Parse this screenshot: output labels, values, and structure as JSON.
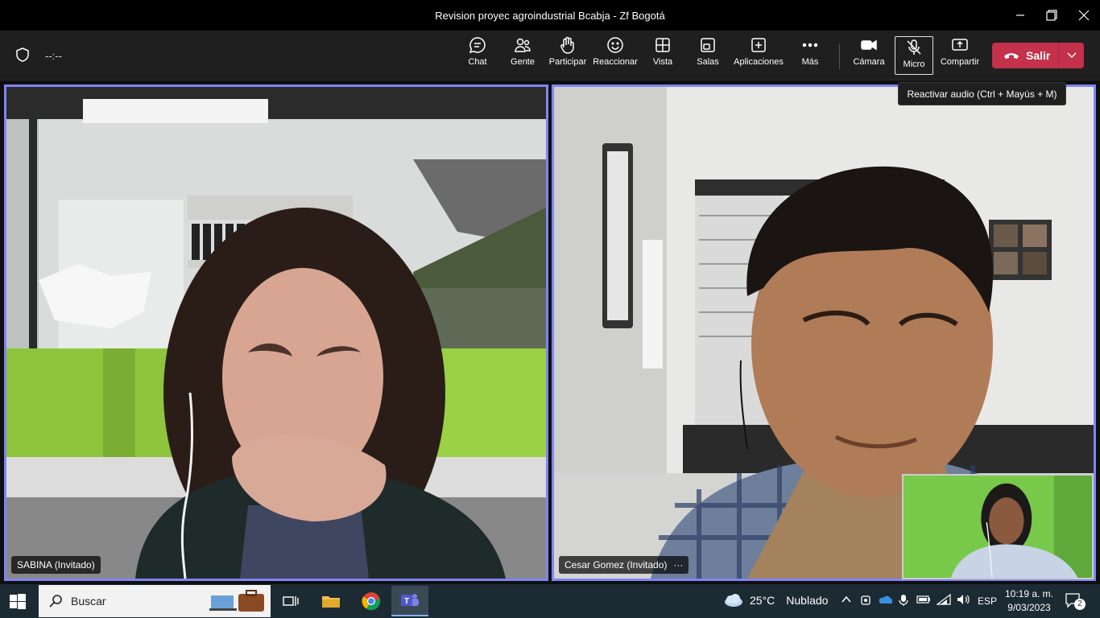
{
  "window": {
    "title": "Revision proyec agroindustrial Bcabja - Zf Bogotá"
  },
  "toolbar": {
    "timer": "--:--",
    "buttons": {
      "chat": "Chat",
      "people": "Gente",
      "raise": "Participar",
      "react": "Reaccionar",
      "view": "Vista",
      "rooms": "Salas",
      "apps": "Aplicaciones",
      "more": "Más",
      "camera": "Cámara",
      "mic": "Micro",
      "share": "Compartir"
    },
    "leave_label": "Salir",
    "mic_tooltip": "Reactivar audio (Ctrl + Mayús + M)"
  },
  "participants": [
    {
      "name": "SABINA (Invitado)"
    },
    {
      "name": "Cesar Gomez (Invitado)"
    }
  ],
  "taskbar": {
    "search_placeholder": "Buscar",
    "weather_temp": "25°C",
    "weather_desc": "Nublado",
    "language": "ESP",
    "time": "10:19 a. m.",
    "date": "9/03/2023",
    "notification_count": "2"
  },
  "colors": {
    "accent_border": "#7f85f5",
    "leave_red": "#c4314b",
    "taskbar": "#1c2b33"
  }
}
